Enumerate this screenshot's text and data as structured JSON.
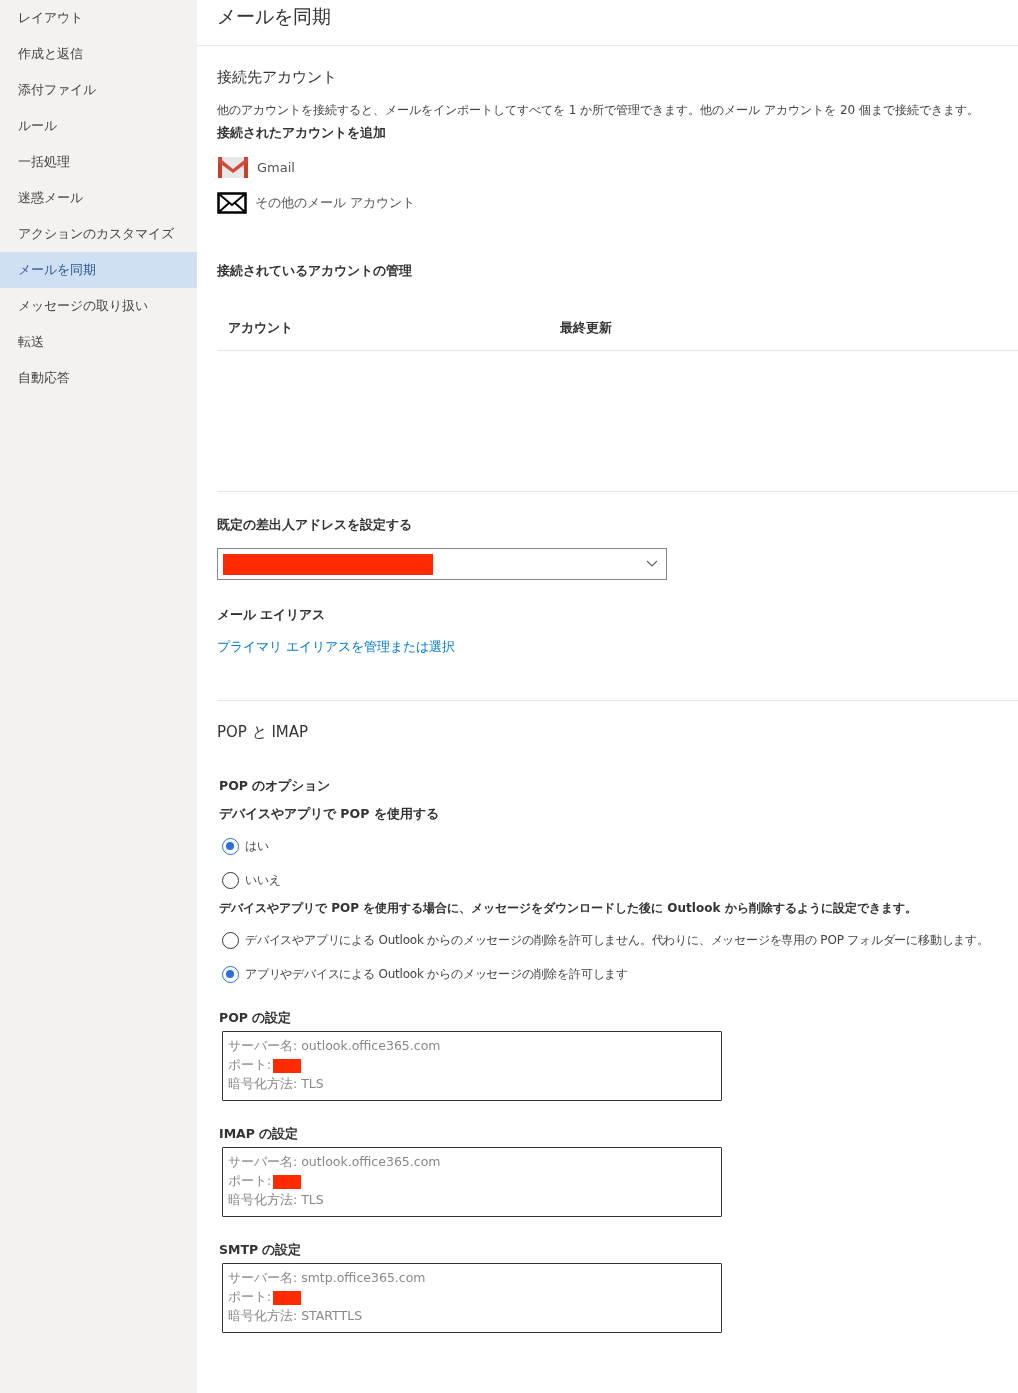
{
  "sidebar": {
    "items": [
      {
        "label": "レイアウト",
        "selected": false
      },
      {
        "label": "作成と返信",
        "selected": false
      },
      {
        "label": "添付ファイル",
        "selected": false
      },
      {
        "label": "ルール",
        "selected": false
      },
      {
        "label": "一括処理",
        "selected": false
      },
      {
        "label": "迷惑メール",
        "selected": false
      },
      {
        "label": "アクションのカスタマイズ",
        "selected": false
      },
      {
        "label": "メールを同期",
        "selected": true
      },
      {
        "label": "メッセージの取り扱い",
        "selected": false
      },
      {
        "label": "転送",
        "selected": false
      },
      {
        "label": "自動応答",
        "selected": false
      }
    ]
  },
  "page_title": "メールを同期",
  "connected_accounts": {
    "heading": "接続先アカウント",
    "description": "他のアカウントを接続すると、メールをインポートしてすべてを 1 か所で管理できます。他のメール アカウントを 20 個まで接続できます。",
    "add_label": "接続されたアカウントを追加",
    "providers": [
      {
        "kind": "gmail",
        "label": "Gmail"
      },
      {
        "kind": "other",
        "label": "その他のメール アカウント"
      }
    ],
    "manage_label": "接続されているアカウントの管理",
    "table": {
      "columns": [
        "アカウント",
        "最終更新"
      ]
    }
  },
  "default_from": {
    "heading": "既定の差出人アドレスを設定する",
    "value_redacted": true
  },
  "alias": {
    "heading": "メール エイリアス",
    "link": "プライマリ エイリアスを管理または選択"
  },
  "pop_imap": {
    "heading": "POP と IMAP",
    "pop_options_label": "POP のオプション",
    "use_pop_label": "デバイスやアプリで POP を使用する",
    "use_pop_options": [
      {
        "label": "はい",
        "selected": true
      },
      {
        "label": "いいえ",
        "selected": false
      }
    ],
    "delete_note": "デバイスやアプリで POP を使用する場合に、メッセージをダウンロードした後に Outlook から削除するように設定できます。",
    "delete_options": [
      {
        "label": "デバイスやアプリによる Outlook からのメッセージの削除を許可しません。代わりに、メッセージを専用の POP フォルダーに移動します。",
        "selected": false
      },
      {
        "label": "アプリやデバイスによる Outlook からのメッセージの削除を許可します",
        "selected": true
      }
    ],
    "settings": [
      {
        "title": "POP の設定",
        "lines": [
          {
            "kind": "text",
            "text": "サーバー名: outlook.office365.com"
          },
          {
            "kind": "redacted",
            "text": "ポート:"
          },
          {
            "kind": "text",
            "text": "暗号化方法: TLS"
          }
        ]
      },
      {
        "title": "IMAP の設定",
        "lines": [
          {
            "kind": "text",
            "text": "サーバー名: outlook.office365.com"
          },
          {
            "kind": "redacted",
            "text": "ポート:"
          },
          {
            "kind": "text",
            "text": "暗号化方法: TLS"
          }
        ]
      },
      {
        "title": "SMTP の設定",
        "lines": [
          {
            "kind": "text",
            "text": "サーバー名: smtp.office365.com"
          },
          {
            "kind": "redacted",
            "text": "ポート:"
          },
          {
            "kind": "text",
            "text": "暗号化方法: STARTTLS"
          }
        ]
      }
    ]
  }
}
